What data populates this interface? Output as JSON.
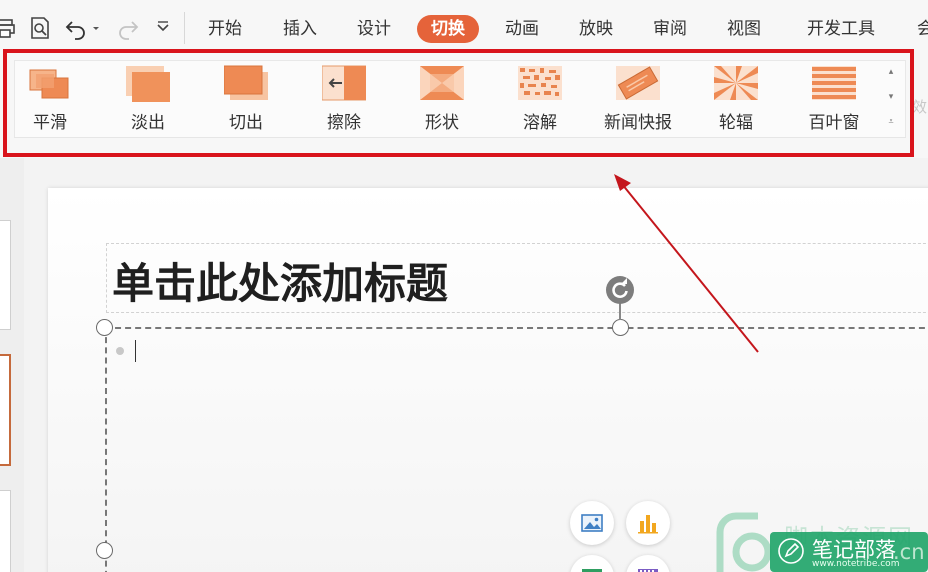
{
  "menubar": {
    "quick_access": [
      {
        "icon": "print-icon"
      },
      {
        "icon": "print-preview-icon"
      },
      {
        "icon": "undo-icon"
      },
      {
        "icon": "undo-dropdown-icon"
      },
      {
        "icon": "redo-icon"
      },
      {
        "icon": "customize-quick-access-icon"
      }
    ],
    "tabs": [
      {
        "label": "开始"
      },
      {
        "label": "插入"
      },
      {
        "label": "设计"
      },
      {
        "label": "切换",
        "active": true
      },
      {
        "label": "动画"
      },
      {
        "label": "放映"
      },
      {
        "label": "审阅"
      },
      {
        "label": "视图"
      },
      {
        "label": "开发工具"
      },
      {
        "label": "会"
      }
    ],
    "active_color": "#e5633a"
  },
  "ribbon": {
    "transitions": [
      {
        "label": "平滑",
        "icon": "smooth-transition-icon"
      },
      {
        "label": "淡出",
        "icon": "fade-transition-icon"
      },
      {
        "label": "切出",
        "icon": "cut-transition-icon"
      },
      {
        "label": "擦除",
        "icon": "wipe-transition-icon"
      },
      {
        "label": "形状",
        "icon": "shape-transition-icon"
      },
      {
        "label": "溶解",
        "icon": "dissolve-transition-icon"
      },
      {
        "label": "新闻快报",
        "icon": "newsflash-transition-icon"
      },
      {
        "label": "轮辐",
        "icon": "wheel-transition-icon"
      },
      {
        "label": "百叶窗",
        "icon": "blinds-transition-icon"
      }
    ],
    "scroll": {
      "up_icon": "scroll-up-icon",
      "down_icon": "scroll-down-icon",
      "more_icon": "more-icon"
    },
    "faded_text": "效",
    "highlight_color": "#d9141c"
  },
  "slide": {
    "title_placeholder": "单击此处添加标题",
    "insert_icons": [
      "picture-icon",
      "chart-icon",
      "table-icon",
      "video-icon"
    ]
  },
  "watermark": {
    "top_text": "脚本资源网",
    "main_text": "笔记部落",
    "url": "www.notetribe.com",
    "suffix": ".cn"
  }
}
